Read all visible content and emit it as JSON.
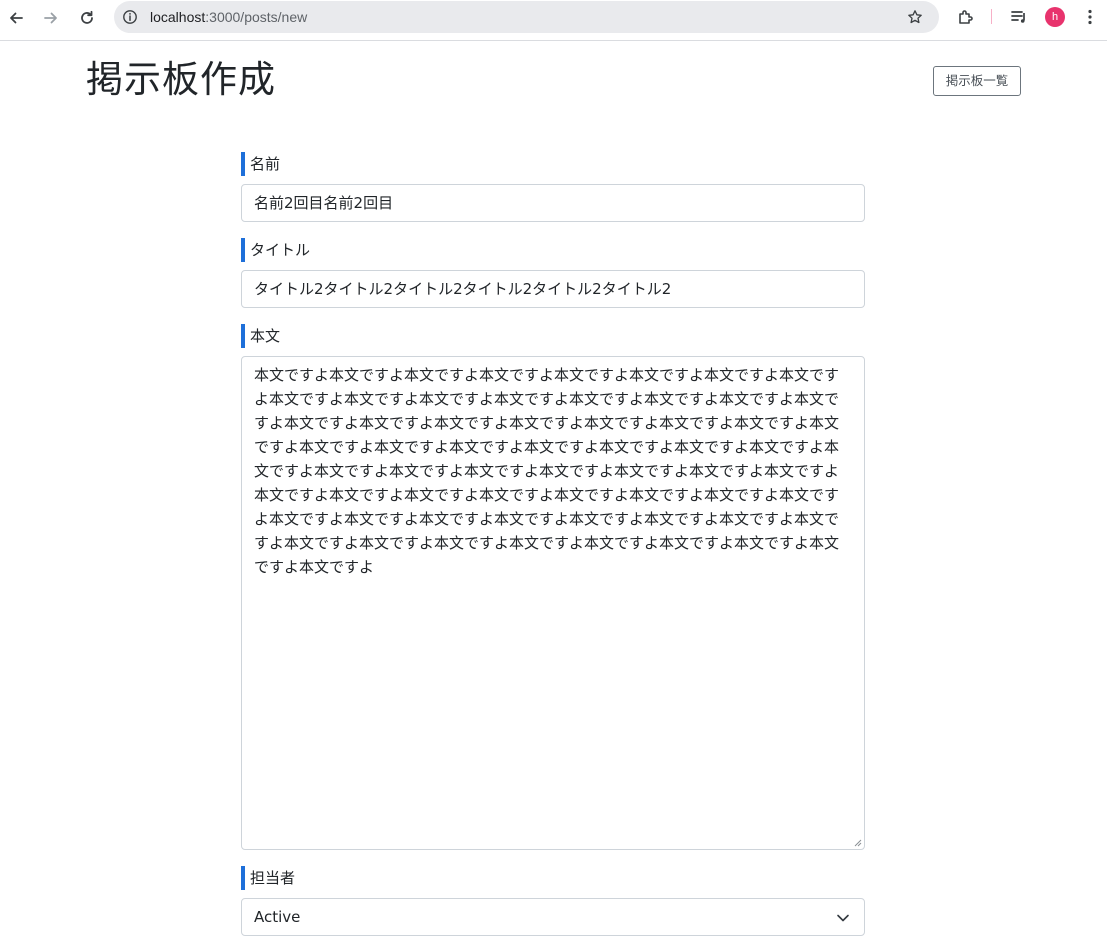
{
  "browser": {
    "url_host": "localhost",
    "url_path": ":3000/posts/new",
    "profile_initial": "h",
    "icons": [
      "back-icon",
      "forward-icon",
      "reload-icon",
      "info-icon",
      "star-icon",
      "extensions-icon",
      "media-icon",
      "menu-icon"
    ]
  },
  "header": {
    "title": "掲示板作成",
    "list_button": "掲示板一覧"
  },
  "form": {
    "name": {
      "label": "名前",
      "value": "名前2回目名前2回目"
    },
    "title": {
      "label": "タイトル",
      "value": "タイトル2タイトル2タイトル2タイトル2タイトル2タイトル2"
    },
    "body": {
      "label": "本文",
      "value": "本文ですよ本文ですよ本文ですよ本文ですよ本文ですよ本文ですよ本文ですよ本文ですよ本文ですよ本文ですよ本文ですよ本文ですよ本文ですよ本文ですよ本文ですよ本文ですよ本文ですよ本文ですよ本文ですよ本文ですよ本文ですよ本文ですよ本文ですよ本文ですよ本文ですよ本文ですよ本文ですよ本文ですよ本文ですよ本文ですよ本文ですよ本文ですよ本文ですよ本文ですよ本文ですよ本文ですよ本文ですよ本文ですよ本文ですよ本文ですよ本文ですよ本文ですよ本文ですよ本文ですよ本文ですよ本文ですよ本文ですよ本文ですよ本文ですよ本文ですよ本文ですよ本文ですよ本文ですよ本文ですよ本文ですよ本文ですよ本文ですよ本文ですよ本文ですよ本文ですよ本文ですよ本文ですよ本文ですよ本文ですよ"
    },
    "assignee": {
      "label": "担当者",
      "selected": "Active"
    }
  },
  "colors": {
    "accent": "#1e6fd9",
    "avatar": "#e8336d"
  }
}
